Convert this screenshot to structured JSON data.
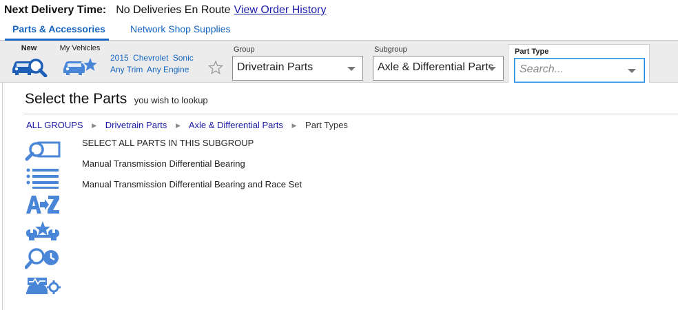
{
  "delivery": {
    "label": "Next Delivery Time:",
    "status": "No Deliveries En Route",
    "history_link": "View Order History"
  },
  "top_tabs": [
    {
      "label": "Parts & Accessories",
      "active": true
    },
    {
      "label": "Network Shop Supplies",
      "active": false
    }
  ],
  "vehicle_bar": {
    "new_label": "New",
    "my_vehicles_label": "My Vehicles",
    "vehicle": {
      "year": "2015",
      "make": "Chevrolet",
      "model": "Sonic",
      "trim": "Any Trim",
      "engine": "Any Engine"
    }
  },
  "selectors": {
    "group": {
      "label": "Group",
      "value": "Drivetrain Parts"
    },
    "subgroup": {
      "label": "Subgroup",
      "value": "Axle & Differential Parts"
    },
    "part_type": {
      "label": "Part Type",
      "placeholder": "Search..."
    }
  },
  "page": {
    "title": "Select the Parts",
    "subtitle": "you wish to lookup"
  },
  "breadcrumb": {
    "items": [
      "ALL GROUPS",
      "Drivetrain Parts",
      "Axle & Differential Parts"
    ],
    "current": "Part Types"
  },
  "side_icons": [
    "search-parts-icon",
    "list-view-icon",
    "a-to-z-icon",
    "tools-star-icon",
    "search-clock-icon",
    "vehicle-diagnostic-icon"
  ],
  "parts": [
    "SELECT ALL PARTS IN THIS SUBGROUP",
    "Manual Transmission Differential Bearing",
    "Manual Transmission Differential Bearing and Race Set"
  ],
  "colors": {
    "accent": "#1565c0",
    "icon_blue": "#4a86d8",
    "link": "#1a1aaa"
  }
}
